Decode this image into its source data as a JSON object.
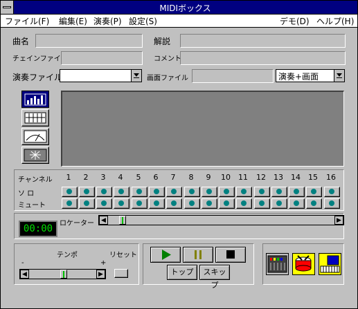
{
  "window": {
    "title": "MIDIボックス"
  },
  "menu": [
    {
      "label": "ファイル(F)"
    },
    {
      "label": "編集(E)"
    },
    {
      "label": "演奏(P)"
    },
    {
      "label": "設定(S)"
    },
    {
      "label": "デモ(D)"
    },
    {
      "label": "ヘルプ(H)"
    }
  ],
  "fields": {
    "title_label": "曲名",
    "title_value": "",
    "desc_label": "解説",
    "desc_value": "",
    "chain_label": "チェインファイル",
    "chain_value": "",
    "comment_label": "コメント",
    "comment_value": "",
    "play_file_label": "演奏ファイル",
    "play_file_value": "",
    "screen_file_label": "画面ファイル",
    "screen_file_value": "",
    "mode_value": "演奏+画面"
  },
  "view_buttons": [
    {
      "icon": "equalizer-bars-icon",
      "selected": true
    },
    {
      "icon": "channel-grid-icon",
      "selected": false
    },
    {
      "icon": "meter-gauge-icon",
      "selected": false
    },
    {
      "icon": "starburst-icon",
      "selected": false
    }
  ],
  "channels": {
    "channel_label": "チャンネル",
    "solo_label": "ソ ロ",
    "mute_label": "ミュート",
    "numbers": [
      "1",
      "2",
      "3",
      "4",
      "5",
      "6",
      "7",
      "8",
      "9",
      "10",
      "11",
      "12",
      "13",
      "14",
      "15",
      "16"
    ]
  },
  "counter": {
    "time": "00:00"
  },
  "locator": {
    "label": "ロケーター",
    "position": 0.05
  },
  "tempo": {
    "label": "テンポ",
    "minus": "-",
    "plus": "+",
    "reset_label": "リセット",
    "position": 0.5
  },
  "transport": {
    "play_icon": "play-icon",
    "pause_icon": "pause-icon",
    "stop_icon": "stop-icon",
    "top_label": "トップ",
    "skip_label": "スキップ"
  },
  "tools": [
    {
      "icon": "mixer-panel-icon"
    },
    {
      "icon": "drum-icon"
    },
    {
      "icon": "keyboard-monitor-icon"
    }
  ],
  "colors": {
    "title_bar": "#000080",
    "led": "#00e000",
    "channel_dot": "#008080",
    "play": "#008000",
    "pause": "#808000"
  }
}
